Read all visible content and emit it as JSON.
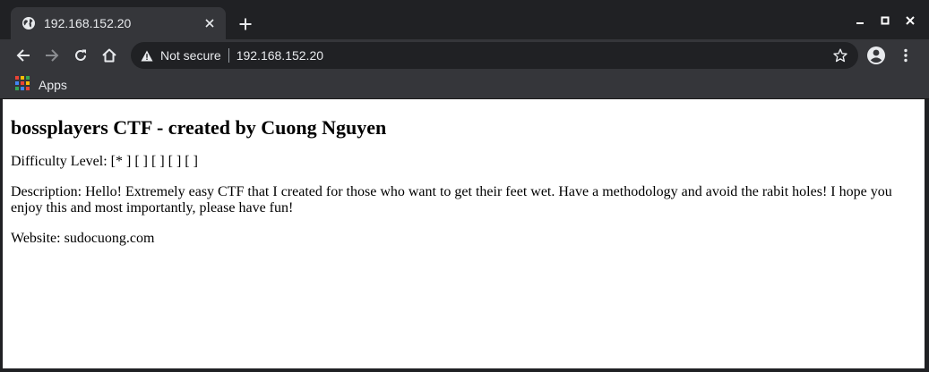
{
  "browser": {
    "tab": {
      "title": "192.168.152.20"
    },
    "omnibox": {
      "security_label": "Not secure",
      "url": "192.168.152.20"
    },
    "bookmarks": {
      "apps_label": "Apps"
    }
  },
  "page": {
    "heading": "bossplayers CTF - created by Cuong Nguyen",
    "difficulty": "Difficulty Level: [* ] [ ] [ ] [ ] [ ]",
    "description": "Description: Hello! Extremely easy CTF that I created for those who want to get their feet wet. Have a methodology and avoid the rabit holes! I hope you enjoy this and most importantly, please have fun!",
    "website": "Website: sudocuong.com"
  },
  "icons": {
    "favicon": "globe-icon",
    "tab_close": "close-icon",
    "new_tab": "plus-icon",
    "minimize": "minimize-icon",
    "maximize": "maximize-icon",
    "close_window": "close-icon",
    "back": "arrow-left-icon",
    "forward": "arrow-right-icon",
    "reload": "reload-icon",
    "home": "home-icon",
    "warning": "warning-icon",
    "bookmark": "star-icon",
    "profile": "account-icon",
    "menu": "kebab-menu-icon",
    "apps": "apps-grid-icon"
  },
  "colors": {
    "chrome_dark": "#202124",
    "toolbar": "#35363a",
    "text_light": "#e8eaed",
    "page_bg": "#ffffff"
  }
}
